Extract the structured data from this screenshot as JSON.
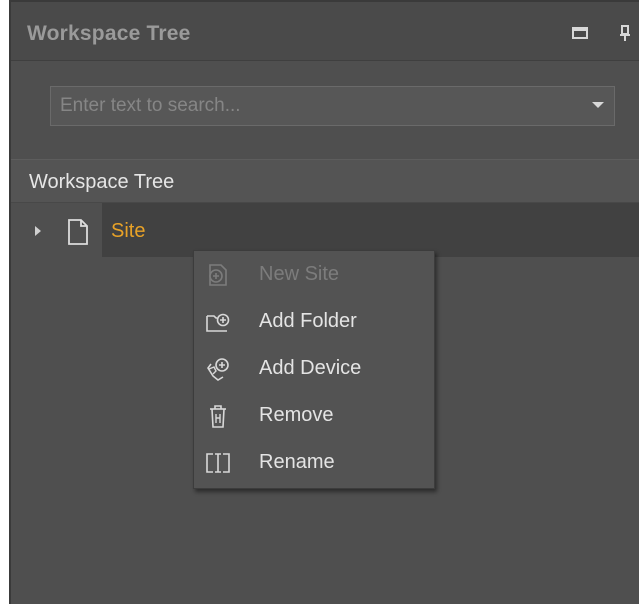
{
  "panel": {
    "title": "Workspace Tree",
    "buttons": [
      {
        "name": "restore-icon"
      },
      {
        "name": "pin-icon"
      }
    ]
  },
  "search": {
    "value": "",
    "placeholder": "Enter text to search..."
  },
  "tree": {
    "header": "Workspace Tree",
    "nodes": [
      {
        "label": "Site",
        "icon": "document-icon",
        "expanded": false,
        "selected": true,
        "color": "#e8a227"
      }
    ]
  },
  "context_menu": {
    "items": [
      {
        "label": "New Site",
        "icon": "new-site-icon",
        "enabled": false
      },
      {
        "label": "Add Folder",
        "icon": "add-folder-icon",
        "enabled": true
      },
      {
        "label": "Add Device",
        "icon": "add-device-icon",
        "enabled": true
      },
      {
        "label": "Remove",
        "icon": "trash-icon",
        "enabled": true
      },
      {
        "label": "Rename",
        "icon": "rename-icon",
        "enabled": true
      }
    ]
  },
  "colors": {
    "panel_bg": "#4f4f4f",
    "accent": "#e8a227",
    "text": "#e4e4e4",
    "disabled_text": "#7c7c7c"
  }
}
